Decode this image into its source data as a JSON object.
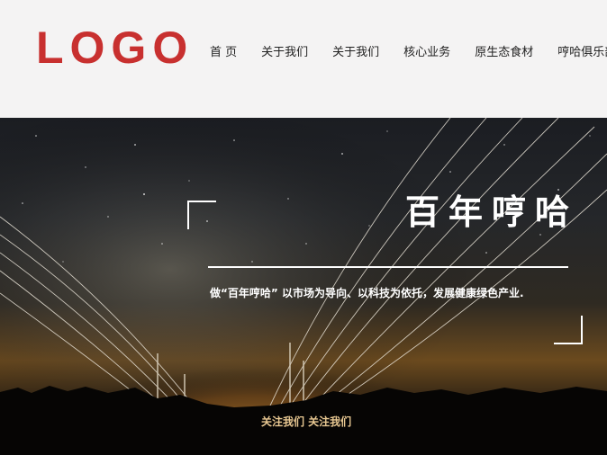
{
  "header": {
    "logo_text": "LOGO",
    "nav": [
      "首 页",
      "关于我们",
      "关于我们",
      "核心业务",
      "原生态食材",
      "哼哈俱乐部"
    ]
  },
  "hero": {
    "title": "百年哼哈",
    "subtitle": "做“百年哼哈” 以市场为导向、以科技为依托，发展健康绿色产业.",
    "follow_link": "关注我们 关注我们"
  },
  "colors": {
    "brand_red": "#c8302f",
    "header_bg": "#f4f3f3",
    "follow_text": "#e8c892"
  }
}
